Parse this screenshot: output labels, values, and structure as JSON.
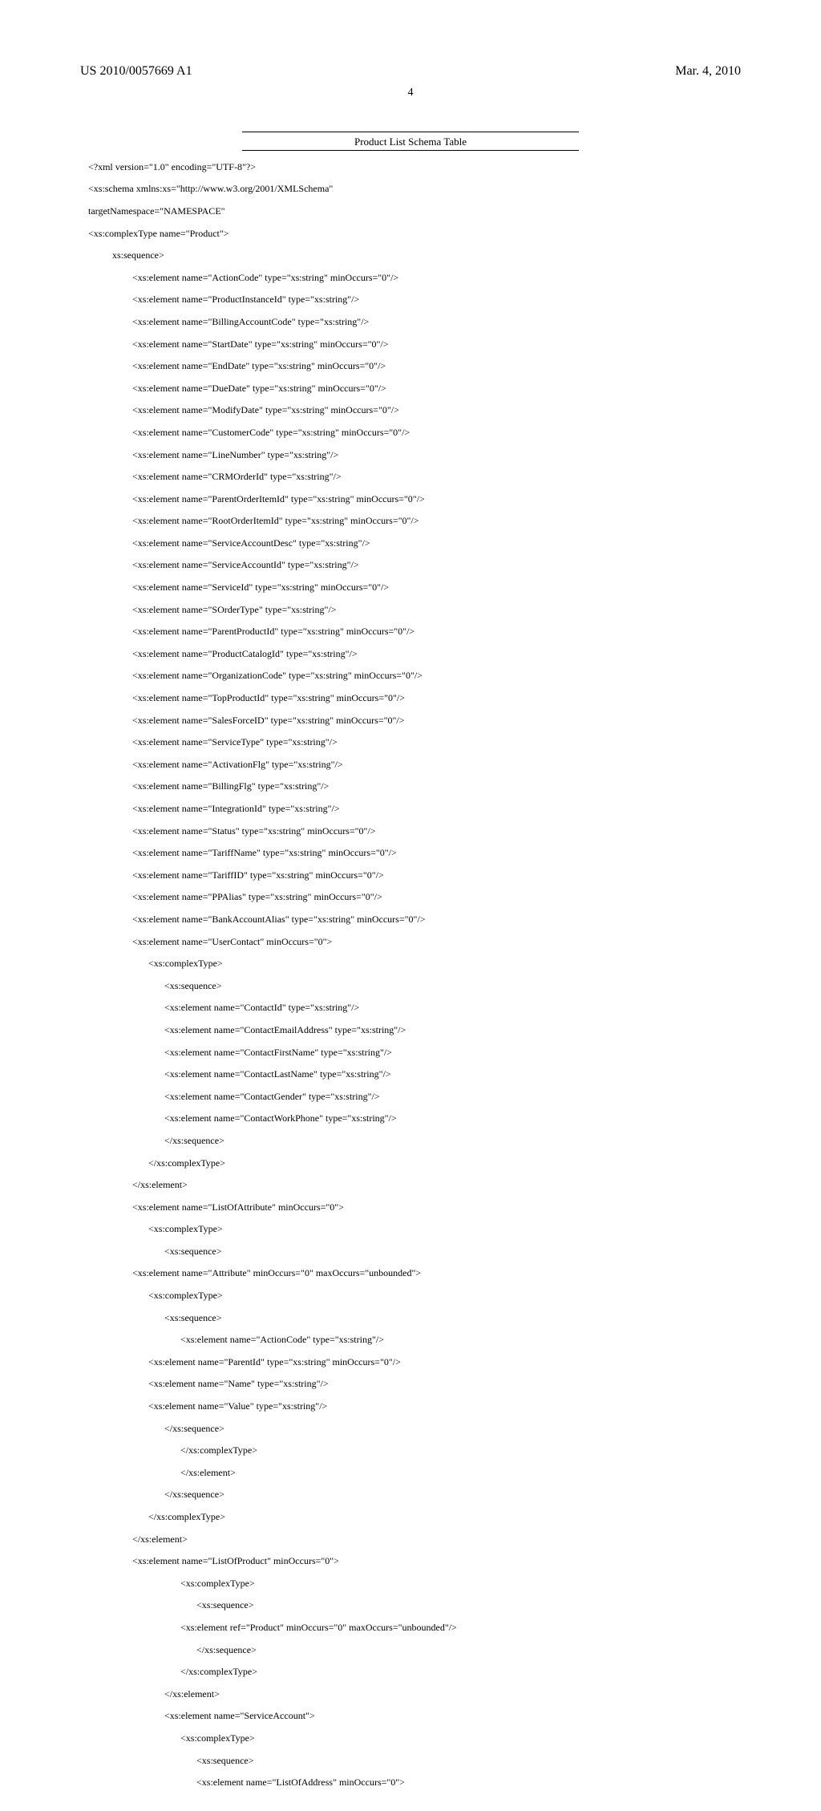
{
  "header": {
    "pubno": "US 2010/0057669 A1",
    "date": "Mar. 4, 2010",
    "pageno": "4"
  },
  "table": {
    "title": "Product List Schema Table"
  },
  "code": {
    "l0": "<?xml version=\"1.0\" encoding=\"UTF-8\"?>",
    "l1": "<xs:schema xmlns:xs=\"http://www.w3.org/2001/XMLSchema\"",
    "l2": "targetNamespace=\"NAMESPACE\"",
    "l3": "<xs:complexType name=\"Product\">",
    "l4": "xs:sequence>",
    "l5": "<xs:element name=\"ActionCode\" type=\"xs:string\" minOccurs=\"0\"/>",
    "l6": "<xs:element name=\"ProductInstanceId\" type=\"xs:string\"/>",
    "l7": "<xs:element name=\"BillingAccountCode\" type=\"xs:string\"/>",
    "l8": "<xs:element name=\"StartDate\" type=\"xs:string\" minOccurs=\"0\"/>",
    "l9": "<xs:element name=\"EndDate\" type=\"xs:string\" minOccurs=\"0\"/>",
    "l10": "<xs:element name=\"DueDate\" type=\"xs:string\" minOccurs=\"0\"/>",
    "l11": "<xs:element name=\"ModifyDate\" type=\"xs:string\" minOccurs=\"0\"/>",
    "l12": "<xs:element name=\"CustomerCode\" type=\"xs:string\" minOccurs=\"0\"/>",
    "l13": "<xs:element name=\"LineNumber\" type=\"xs:string\"/>",
    "l14": "<xs:element name=\"CRMOrderId\" type=\"xs:string\"/>",
    "l15": "<xs:element name=\"ParentOrderItemId\" type=\"xs:string\" minOccurs=\"0\"/>",
    "l16": "<xs:element name=\"RootOrderItemId\" type=\"xs:string\" minOccurs=\"0\"/>",
    "l17": "<xs:element name=\"ServiceAccountDesc\" type=\"xs:string\"/>",
    "l18": "<xs:element name=\"ServiceAccountId\" type=\"xs:string\"/>",
    "l19": "<xs:element name=\"ServiceId\" type=\"xs:string\" minOccurs=\"0\"/>",
    "l20": "<xs:element name=\"SOrderType\" type=\"xs:string\"/>",
    "l21": "<xs:element name=\"ParentProductId\" type=\"xs:string\" minOccurs=\"0\"/>",
    "l22": "<xs:element name=\"ProductCatalogId\" type=\"xs:string\"/>",
    "l23": "<xs:element name=\"OrganizationCode\" type=\"xs:string\" minOccurs=\"0\"/>",
    "l24": "<xs:element name=\"TopProductId\" type=\"xs:string\" minOccurs=\"0\"/>",
    "l25": "<xs:element name=\"SalesForceID\" type=\"xs:string\" minOccurs=\"0\"/>",
    "l26": "<xs:element name=\"ServiceType\" type=\"xs:string\"/>",
    "l27": "<xs:element name=\"ActivationFlg\" type=\"xs:string\"/>",
    "l28": "<xs:element name=\"BillingFlg\" type=\"xs:string\"/>",
    "l29": "<xs:element name=\"IntegrationId\" type=\"xs:string\"/>",
    "l30": "<xs:element name=\"Status\" type=\"xs:string\" minOccurs=\"0\"/>",
    "l31": "<xs:element name=\"TariffName\" type=\"xs:string\" minOccurs=\"0\"/>",
    "l32": "<xs:element name=\"TariffID\" type=\"xs:string\" minOccurs=\"0\"/>",
    "l33": "<xs:element name=\"PPAlias\" type=\"xs:string\" minOccurs=\"0\"/>",
    "l34": "<xs:element name=\"BankAccountAlias\" type=\"xs:string\" minOccurs=\"0\"/>",
    "l35": "<xs:element name=\"UserContact\" minOccurs=\"0\">",
    "l36": "<xs:complexType>",
    "l37": "<xs:sequence>",
    "l38": "<xs:element name=\"ContactId\" type=\"xs:string\"/>",
    "l39": "<xs:element name=\"ContactEmailAddress\" type=\"xs:string\"/>",
    "l40": "<xs:element name=\"ContactFirstName\" type=\"xs:string\"/>",
    "l41": "<xs:element name=\"ContactLastName\" type=\"xs:string\"/>",
    "l42": "<xs:element name=\"ContactGender\" type=\"xs:string\"/>",
    "l43": "<xs:element name=\"ContactWorkPhone\" type=\"xs:string\"/>",
    "l44": "</xs:sequence>",
    "l45": "</xs:complexType>",
    "l46": "</xs:element>",
    "l47": "<xs:element name=\"ListOfAttribute\" minOccurs=\"0\">",
    "l48": "<xs:complexType>",
    "l49": "<xs:sequence>",
    "l50": "<xs:element name=\"Attribute\" minOccurs=\"0\" maxOccurs=\"unbounded\">",
    "l51": "<xs:complexType>",
    "l52": "<xs:sequence>",
    "l53": "<xs:element name=\"ActionCode\" type=\"xs:string\"/>",
    "l54": "<xs:element name=\"ParentId\" type=\"xs:string\" minOccurs=\"0\"/>",
    "l55": "<xs:element name=\"Name\" type=\"xs:string\"/>",
    "l56": "<xs:element name=\"Value\" type=\"xs:string\"/>",
    "l57": "</xs:sequence>",
    "l58": "</xs:complexType>",
    "l59": "</xs:element>",
    "l60": "</xs:sequence>",
    "l61": "</xs:complexType>",
    "l62": "</xs:element>",
    "l63": "<xs:element name=\"ListOfProduct\" minOccurs=\"0\">",
    "l64": "<xs:complexType>",
    "l65": "<xs:sequence>",
    "l66": "<xs:element ref=\"Product\" minOccurs=\"0\" maxOccurs=\"unbounded\"/>",
    "l67": "</xs:sequence>",
    "l68": "</xs:complexType>",
    "l69": "</xs:element>",
    "l70": "<xs:element name=\"ServiceAccount\">",
    "l71": "<xs:complexType>",
    "l72": "<xs:sequence>",
    "l73": "<xs:element name=\"ListOfAddress\" minOccurs=\"0\">"
  }
}
